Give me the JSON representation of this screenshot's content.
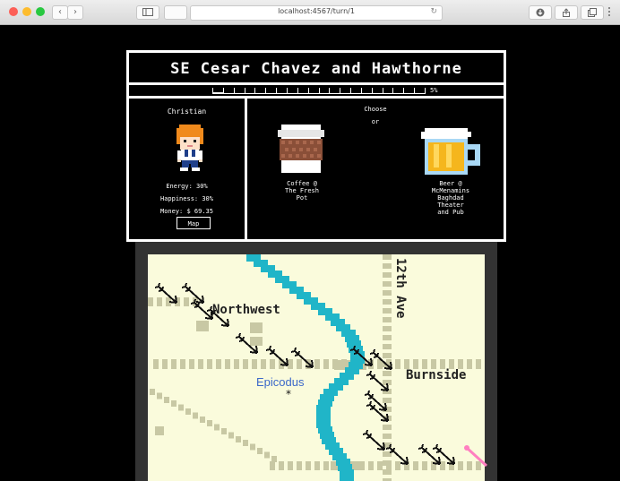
{
  "browser": {
    "url": "localhost:4567/turn/1",
    "back_glyph": "‹",
    "forward_glyph": "›"
  },
  "game": {
    "location_title": "SE Cesar Chavez and Hawthorne",
    "progress_percent": 5,
    "progress_label": "5%",
    "player": {
      "name": "Christian",
      "energy_label": "Energy: 30%",
      "happiness_label": "Happiness: 30%",
      "money_label": "Money: $ 69.35"
    },
    "map_button_label": "Map",
    "choose_label": "Choose",
    "or_label": "or",
    "choices": [
      {
        "name": "coffee",
        "lines": [
          "Coffee @",
          "The Fresh",
          "Pot"
        ]
      },
      {
        "name": "beer",
        "lines": [
          "Beer @",
          "McMenamins",
          "Baghdad",
          "Theater",
          "and Pub"
        ]
      }
    ]
  },
  "map": {
    "labels": {
      "northwest": "Northwest",
      "twelfth_ave": "12th Ave",
      "burnside": "Burnside",
      "epicodus": "Epicodus",
      "epicodus_marker": "*"
    },
    "colors": {
      "background": "#fafbdc",
      "river": "#20b5c8",
      "road": "#c8c8a4",
      "epicodus": "#3b68c9",
      "frame": "#333333"
    }
  }
}
